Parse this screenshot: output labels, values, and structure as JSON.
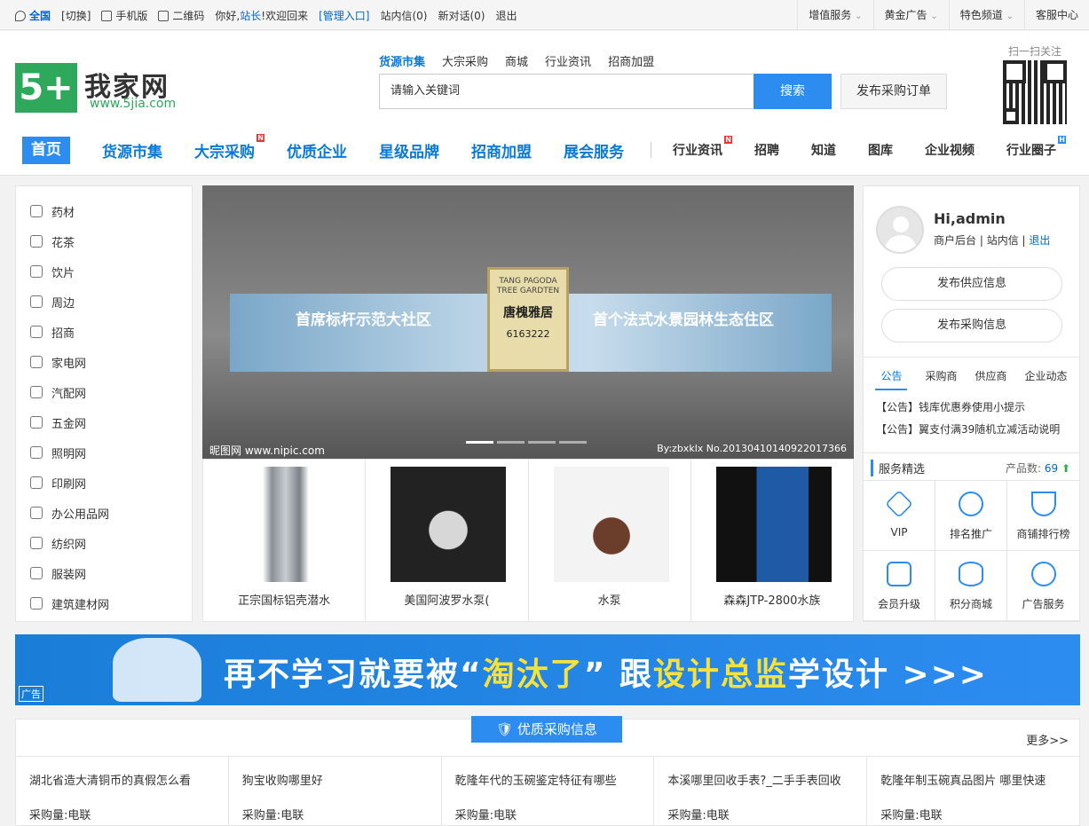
{
  "topbar": {
    "location": "全国",
    "switch": "[切换]",
    "mobile": "手机版",
    "qrcode": "二维码",
    "greeting": "你好,",
    "site_owner": "站长",
    "welcome": "!欢迎回来",
    "admin_entry": "[管理入口]",
    "inbox": "站内信(0)",
    "new_chat": "新对话(0)",
    "logout": "退出",
    "menus": [
      "增值服务",
      "黄金广告",
      "特色频道",
      "客服中心"
    ]
  },
  "logo": {
    "mark": "5+",
    "name": "我家网",
    "url": "www.5jia.com"
  },
  "search": {
    "tabs": [
      "货源市集",
      "大宗采购",
      "商城",
      "行业资讯",
      "招商加盟"
    ],
    "placeholder": "请输入关键词",
    "button": "搜索",
    "publish": "发布采购订单"
  },
  "qr": {
    "label": "扫一扫关注"
  },
  "nav": {
    "main": [
      "首页",
      "货源市集",
      "大宗采购",
      "优质企业",
      "星级品牌",
      "招商加盟",
      "展会服务"
    ],
    "sub": [
      "行业资讯",
      "招聘",
      "知道",
      "图库",
      "企业视频",
      "行业圈子"
    ],
    "badge_new": "N",
    "badge_hot": "H"
  },
  "categories": [
    "药材",
    "花茶",
    "饮片",
    "周边",
    "招商",
    "家电网",
    "汽配网",
    "五金网",
    "照明网",
    "印刷网",
    "办公用品网",
    "纺织网",
    "服装网",
    "建筑建材网"
  ],
  "banner": {
    "headline_left": "首席标杆示范大社区",
    "headline_right": "首个法式水景园林生态住区",
    "plaque_en": "TANG PAGODA TREE GARDTEN",
    "plaque_cn": "唐槐雅居",
    "plaque_phone": "6163222",
    "watermark_left": "昵图网 www.nipic.com",
    "watermark_right": "By:zbxklx No.20130410140922017366"
  },
  "products": [
    "正宗国标铝壳潜水",
    "美国阿波罗水泵(",
    "水泵",
    "森森JTP-2800水族"
  ],
  "user": {
    "hi": "Hi,admin",
    "backend": "商户后台",
    "inbox": "站内信",
    "logout": "退出",
    "btn_supply": "发布供应信息",
    "btn_purchase": "发布采购信息",
    "tabs": [
      "公告",
      "采购商",
      "供应商",
      "企业动态"
    ],
    "notices": [
      "【公告】钱库优惠券使用小提示",
      "【公告】翼支付满39随机立减活动说明"
    ],
    "service_title": "服务精选",
    "product_count_label": "产品数:",
    "product_count": "69",
    "services": [
      "VIP",
      "排名推广",
      "商铺排行榜",
      "会员升级",
      "积分商城",
      "广告服务"
    ]
  },
  "ad": {
    "slogan_a": "再不学习就要被“",
    "slogan_hl": "淘汰了",
    "slogan_b": "” 跟",
    "slogan_hl2": "设计总监",
    "slogan_c": "学设计 >>>",
    "tag": "广告"
  },
  "purchase": {
    "title": "优质采购信息",
    "more": "更多>>",
    "qty_label": "采购量:",
    "items": [
      {
        "title": "湖北省造大清铜币的真假怎么看",
        "qty": "电联"
      },
      {
        "title": "狗宝收购哪里好",
        "qty": "电联"
      },
      {
        "title": "乾隆年代的玉碗鉴定特征有哪些",
        "qty": "电联"
      },
      {
        "title": "本溪哪里回收手表?_二手手表回收",
        "qty": "电联"
      },
      {
        "title": "乾隆年制玉碗真品图片 哪里快速",
        "qty": "电联"
      }
    ]
  }
}
